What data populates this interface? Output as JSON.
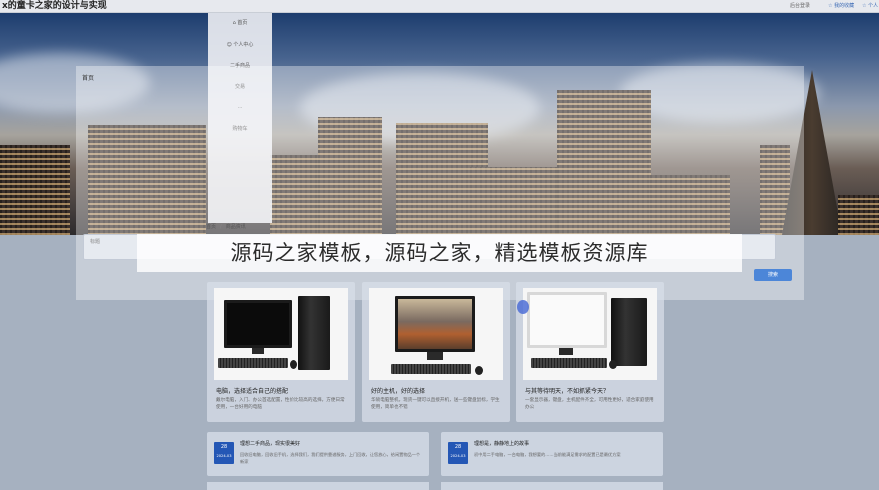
{
  "header": {
    "site_title": "x的童卡之家的设计与实现",
    "login_label": "后台登录",
    "favorites_label": "☆ 我的收藏",
    "user_label": "☆ 个人"
  },
  "sidebar": {
    "items": [
      {
        "label": "⌂ 首页"
      },
      {
        "label": "☺ 个人中心"
      },
      {
        "label": "二手商品"
      },
      {
        "label": "交易"
      },
      {
        "label": "..."
      },
      {
        "label": "购物车"
      }
    ]
  },
  "dialog": {
    "title": "首页"
  },
  "breadcrumb": {
    "home": "首页",
    "current": "商品资讯"
  },
  "search": {
    "label": "标题",
    "button": "搜索"
  },
  "banner": {
    "text": "源码之家模板，源码之家，精选模板资源库"
  },
  "products": [
    {
      "title": "电脑，选择适合自己的搭配",
      "desc": "戴尔电脑，入门、办公首选配置，性价比较高的选择，方便日常使用，一台好用的电脑"
    },
    {
      "title": "好的主机，好的选择",
      "desc": "华硕电脑整机，现货一键可以直接开机，送一些键盘鼠标，学生使用，简单也不错"
    },
    {
      "title": "与其等待明天，不如抓紧今天？",
      "desc": "一套显示器，键盘，主机配件齐全，可用性更好，适合家庭使用办公"
    }
  ],
  "articles": [
    {
      "day": "28",
      "ym": "2024-03",
      "title": "理想二手商品，现实很美好",
      "desc": "回收旧电脑，回收旧手机，选择我们，我们提供靠谱服务，上门回收，让您放心，给闲置物品一个新家"
    },
    {
      "day": "28",
      "ym": "2024-03",
      "title": "理想是，静静地上的故事",
      "desc": "初中用二手电脑，一台电脑，我想要的……当前能满足需求的配置已是最优方案"
    }
  ],
  "colors": {
    "accent": "#2457b5",
    "search_button": "#4c86d8",
    "pointer": "#4d6fd6"
  }
}
